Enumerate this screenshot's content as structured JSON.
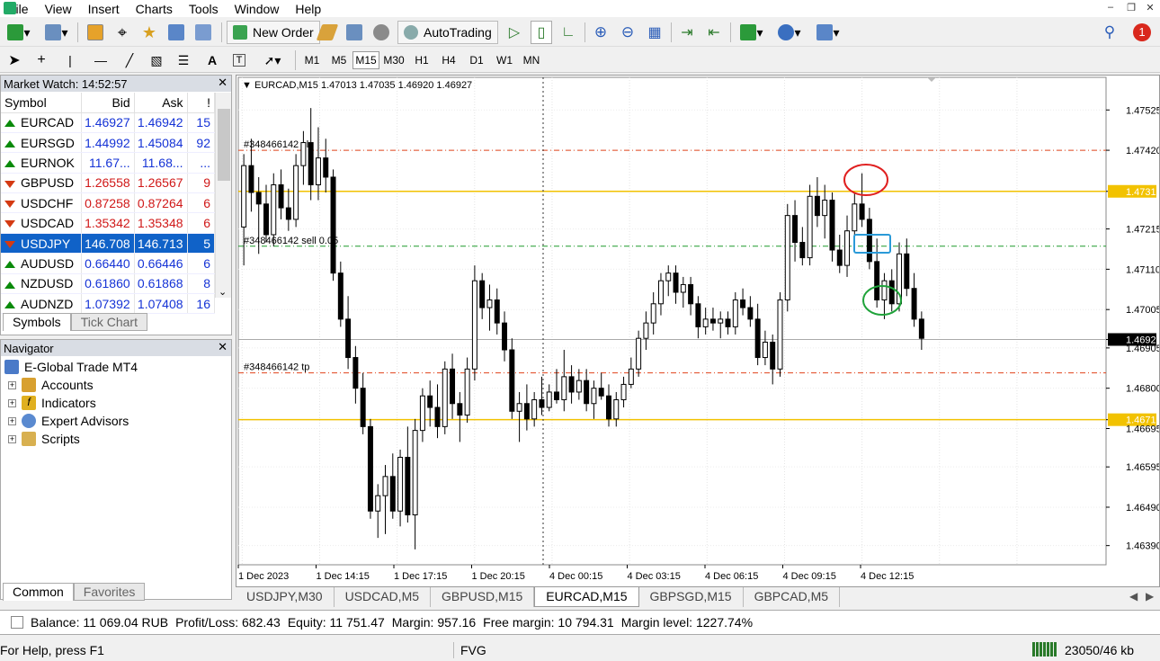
{
  "menu": [
    "File",
    "View",
    "Insert",
    "Charts",
    "Tools",
    "Window",
    "Help"
  ],
  "toolbar": {
    "new_order": "New Order",
    "autotrading": "AutoTrading",
    "notification_count": "1"
  },
  "timeframes": [
    "M1",
    "M5",
    "M15",
    "M30",
    "H1",
    "H4",
    "D1",
    "W1",
    "MN"
  ],
  "active_timeframe": "M15",
  "market_watch": {
    "title": "Market Watch: 14:52:57",
    "columns": [
      "Symbol",
      "Bid",
      "Ask",
      "!"
    ],
    "rows": [
      {
        "symbol": "EURCAD",
        "bid": "1.46927",
        "ask": "1.46942",
        "spread": "15",
        "dir": "up"
      },
      {
        "symbol": "EURSGD",
        "bid": "1.44992",
        "ask": "1.45084",
        "spread": "92",
        "dir": "up"
      },
      {
        "symbol": "EURNOK",
        "bid": "11.67...",
        "ask": "11.68...",
        "spread": "...",
        "dir": "up"
      },
      {
        "symbol": "GBPUSD",
        "bid": "1.26558",
        "ask": "1.26567",
        "spread": "9",
        "dir": "down"
      },
      {
        "symbol": "USDCHF",
        "bid": "0.87258",
        "ask": "0.87264",
        "spread": "6",
        "dir": "down"
      },
      {
        "symbol": "USDCAD",
        "bid": "1.35342",
        "ask": "1.35348",
        "spread": "6",
        "dir": "down"
      },
      {
        "symbol": "USDJPY",
        "bid": "146.708",
        "ask": "146.713",
        "spread": "5",
        "dir": "down",
        "selected": true
      },
      {
        "symbol": "AUDUSD",
        "bid": "0.66440",
        "ask": "0.66446",
        "spread": "6",
        "dir": "up"
      },
      {
        "symbol": "NZDUSD",
        "bid": "0.61860",
        "ask": "0.61868",
        "spread": "8",
        "dir": "up"
      },
      {
        "symbol": "AUDNZD",
        "bid": "1.07392",
        "ask": "1.07408",
        "spread": "16",
        "dir": "up"
      }
    ],
    "tabs": [
      "Symbols",
      "Tick Chart"
    ]
  },
  "navigator": {
    "title": "Navigator",
    "root": "E-Global Trade MT4",
    "items": [
      "Accounts",
      "Indicators",
      "Expert Advisors",
      "Scripts"
    ],
    "tabs": [
      "Common",
      "Favorites"
    ]
  },
  "chart": {
    "header": "EURCAD,M15  1.47013 1.47035 1.46920 1.46927",
    "order_labels": [
      "#348466142 sl",
      "#348466142 sell 0.05",
      "#348466142 tp"
    ],
    "price_ticks": [
      "1.47525",
      "1.47420",
      "1.47313",
      "1.47215",
      "1.47110",
      "1.47005",
      "1.46927",
      "1.46905",
      "1.46800",
      "1.46718",
      "1.46695",
      "1.46595",
      "1.46490",
      "1.46390"
    ],
    "time_ticks": [
      "1 Dec 2023",
      "1 Dec 14:15",
      "1 Dec 17:15",
      "1 Dec 20:15",
      "4 Dec 00:15",
      "4 Dec 03:15",
      "4 Dec 06:15",
      "4 Dec 09:15",
      "4 Dec 12:15"
    ],
    "tabs": [
      "USDJPY,M30",
      "USDCAD,M5",
      "GBPUSD,M15",
      "EURCAD,M15",
      "GBPSGD,M15",
      "GBPCAD,M5"
    ],
    "active_tab": "EURCAD,M15"
  },
  "chart_data": {
    "type": "candlestick",
    "symbol": "EURCAD",
    "ylim": [
      1.4634,
      1.4761
    ],
    "candles": [
      [
        1.4722,
        1.4741,
        1.4712,
        1.4738
      ],
      [
        1.4738,
        1.4745,
        1.4726,
        1.4731
      ],
      [
        1.4731,
        1.4735,
        1.4715,
        1.4728
      ],
      [
        1.4728,
        1.4733,
        1.4718,
        1.472
      ],
      [
        1.472,
        1.4736,
        1.4717,
        1.4733
      ],
      [
        1.4733,
        1.4737,
        1.4724,
        1.4727
      ],
      [
        1.4727,
        1.4732,
        1.4721,
        1.4724
      ],
      [
        1.4724,
        1.4741,
        1.4722,
        1.4738
      ],
      [
        1.4738,
        1.4747,
        1.4733,
        1.4744
      ],
      [
        1.4744,
        1.4753,
        1.4729,
        1.4733
      ],
      [
        1.4733,
        1.4748,
        1.4729,
        1.474
      ],
      [
        1.474,
        1.4745,
        1.4731,
        1.4735
      ],
      [
        1.4735,
        1.4737,
        1.4708,
        1.471
      ],
      [
        1.471,
        1.4713,
        1.4696,
        1.4698
      ],
      [
        1.4698,
        1.4704,
        1.4685,
        1.4688
      ],
      [
        1.4688,
        1.4691,
        1.4676,
        1.468
      ],
      [
        1.468,
        1.4684,
        1.4668,
        1.467
      ],
      [
        1.467,
        1.4672,
        1.4646,
        1.4648
      ],
      [
        1.4648,
        1.4655,
        1.4641,
        1.4652
      ],
      [
        1.4652,
        1.466,
        1.4642,
        1.4657
      ],
      [
        1.4657,
        1.4663,
        1.4646,
        1.4648
      ],
      [
        1.4648,
        1.4664,
        1.4644,
        1.4662
      ],
      [
        1.4662,
        1.467,
        1.4645,
        1.4647
      ],
      [
        1.4647,
        1.4672,
        1.4638,
        1.4669
      ],
      [
        1.4669,
        1.468,
        1.4666,
        1.4678
      ],
      [
        1.4678,
        1.4682,
        1.467,
        1.4675
      ],
      [
        1.4675,
        1.4681,
        1.4667,
        1.467
      ],
      [
        1.467,
        1.4687,
        1.4668,
        1.4685
      ],
      [
        1.4685,
        1.4689,
        1.4672,
        1.4676
      ],
      [
        1.4676,
        1.4679,
        1.4666,
        1.4673
      ],
      [
        1.4673,
        1.4688,
        1.4671,
        1.4685
      ],
      [
        1.4685,
        1.4712,
        1.4682,
        1.4708
      ],
      [
        1.4708,
        1.471,
        1.4698,
        1.4701
      ],
      [
        1.4701,
        1.4707,
        1.4695,
        1.4703
      ],
      [
        1.4703,
        1.4706,
        1.4694,
        1.4697
      ],
      [
        1.4697,
        1.47,
        1.4687,
        1.469
      ],
      [
        1.469,
        1.4693,
        1.4672,
        1.4674
      ],
      [
        1.4674,
        1.4679,
        1.4666,
        1.4676
      ],
      [
        1.4676,
        1.4681,
        1.4669,
        1.4672
      ],
      [
        1.4672,
        1.4679,
        1.467,
        1.4677
      ],
      [
        1.4677,
        1.4683,
        1.4673,
        1.4675
      ],
      [
        1.4675,
        1.4681,
        1.4674,
        1.4679
      ],
      [
        1.4679,
        1.4685,
        1.4676,
        1.4677
      ],
      [
        1.4677,
        1.469,
        1.4674,
        1.4683
      ],
      [
        1.4683,
        1.4686,
        1.4676,
        1.4679
      ],
      [
        1.4679,
        1.4685,
        1.4677,
        1.4682
      ],
      [
        1.4682,
        1.4685,
        1.4674,
        1.4676
      ],
      [
        1.4676,
        1.4682,
        1.4672,
        1.468
      ],
      [
        1.468,
        1.4684,
        1.4677,
        1.4678
      ],
      [
        1.4678,
        1.4681,
        1.467,
        1.4672
      ],
      [
        1.4672,
        1.4679,
        1.467,
        1.4677
      ],
      [
        1.4677,
        1.4683,
        1.4675,
        1.4681
      ],
      [
        1.4681,
        1.4688,
        1.468,
        1.4685
      ],
      [
        1.4685,
        1.4695,
        1.4683,
        1.4693
      ],
      [
        1.4693,
        1.47,
        1.469,
        1.4697
      ],
      [
        1.4697,
        1.4705,
        1.4694,
        1.4702
      ],
      [
        1.4702,
        1.471,
        1.4699,
        1.4708
      ],
      [
        1.4708,
        1.4712,
        1.4704,
        1.471
      ],
      [
        1.471,
        1.4712,
        1.4702,
        1.4705
      ],
      [
        1.4705,
        1.4709,
        1.4701,
        1.4707
      ],
      [
        1.4707,
        1.4709,
        1.4699,
        1.4702
      ],
      [
        1.4702,
        1.4704,
        1.4693,
        1.4696
      ],
      [
        1.4696,
        1.4701,
        1.4694,
        1.4698
      ],
      [
        1.4698,
        1.4701,
        1.4695,
        1.4697
      ],
      [
        1.4697,
        1.47,
        1.4693,
        1.4698
      ],
      [
        1.4698,
        1.47,
        1.4694,
        1.4696
      ],
      [
        1.4696,
        1.4705,
        1.4694,
        1.4703
      ],
      [
        1.4703,
        1.4706,
        1.4699,
        1.4701
      ],
      [
        1.4701,
        1.4704,
        1.4696,
        1.4698
      ],
      [
        1.4698,
        1.4702,
        1.4686,
        1.4688
      ],
      [
        1.4688,
        1.4695,
        1.4686,
        1.4692
      ],
      [
        1.4692,
        1.4694,
        1.4681,
        1.4685
      ],
      [
        1.4685,
        1.4705,
        1.4683,
        1.4703
      ],
      [
        1.4703,
        1.4728,
        1.47,
        1.4725
      ],
      [
        1.4725,
        1.4729,
        1.4713,
        1.4718
      ],
      [
        1.4718,
        1.4722,
        1.4712,
        1.4714
      ],
      [
        1.4714,
        1.4733,
        1.4712,
        1.473
      ],
      [
        1.473,
        1.4735,
        1.4722,
        1.4725
      ],
      [
        1.4725,
        1.4733,
        1.4719,
        1.4729
      ],
      [
        1.4729,
        1.4731,
        1.4713,
        1.4716
      ],
      [
        1.4716,
        1.472,
        1.471,
        1.4712
      ],
      [
        1.4712,
        1.4725,
        1.4709,
        1.4721
      ],
      [
        1.4721,
        1.4731,
        1.4718,
        1.4728
      ],
      [
        1.4728,
        1.4736,
        1.4722,
        1.4724
      ],
      [
        1.4724,
        1.4727,
        1.4711,
        1.4713
      ],
      [
        1.4713,
        1.4719,
        1.4701,
        1.4703
      ],
      [
        1.4703,
        1.471,
        1.4698,
        1.4708
      ],
      [
        1.4708,
        1.4711,
        1.47,
        1.4702
      ],
      [
        1.4702,
        1.4718,
        1.47,
        1.4715
      ],
      [
        1.4715,
        1.4719,
        1.4704,
        1.4706
      ],
      [
        1.4706,
        1.471,
        1.4696,
        1.4698
      ],
      [
        1.4698,
        1.47,
        1.469,
        1.4693
      ]
    ]
  },
  "annotations": [
    {
      "shape": "circle",
      "color": "#e02020"
    },
    {
      "shape": "rect",
      "color": "#2a9ad8"
    },
    {
      "shape": "circle",
      "color": "#1fa33a"
    }
  ],
  "balance_bar": {
    "balance": "Balance: 11 069.04 RUB",
    "profit": "Profit/Loss: 682.43",
    "equity": "Equity: 11 751.47",
    "margin": "Margin: 957.16",
    "free_margin": "Free margin: 10 794.31",
    "margin_level": "Margin level: 1227.74%"
  },
  "status": {
    "help": "For Help, press F1",
    "profile": "FVG",
    "traffic": "23050/46 kb"
  }
}
